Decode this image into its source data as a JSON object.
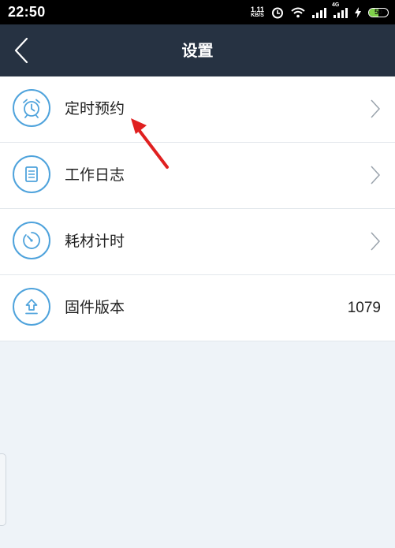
{
  "status_bar": {
    "time": "22:50",
    "net_speed_value": "1.11",
    "net_speed_unit": "KB/S",
    "signal2_tag": "4G",
    "battery_level": "50",
    "battery_color": "#7fd14a"
  },
  "header": {
    "title": "设置",
    "back_icon": "chevron-left-icon",
    "background": "#263242"
  },
  "settings_list": [
    {
      "label": "定时预约",
      "icon": "alarm-clock-icon",
      "has_chevron": true
    },
    {
      "label": "工作日志",
      "icon": "document-icon",
      "has_chevron": true
    },
    {
      "label": "耗材计时",
      "icon": "timer-icon",
      "has_chevron": true
    },
    {
      "label": "固件版本",
      "icon": "upload-icon",
      "value": "1079"
    }
  ],
  "colors": {
    "accent": "#4fa3dc",
    "annotation_arrow": "#e02020",
    "page_background": "#eef3f8"
  }
}
